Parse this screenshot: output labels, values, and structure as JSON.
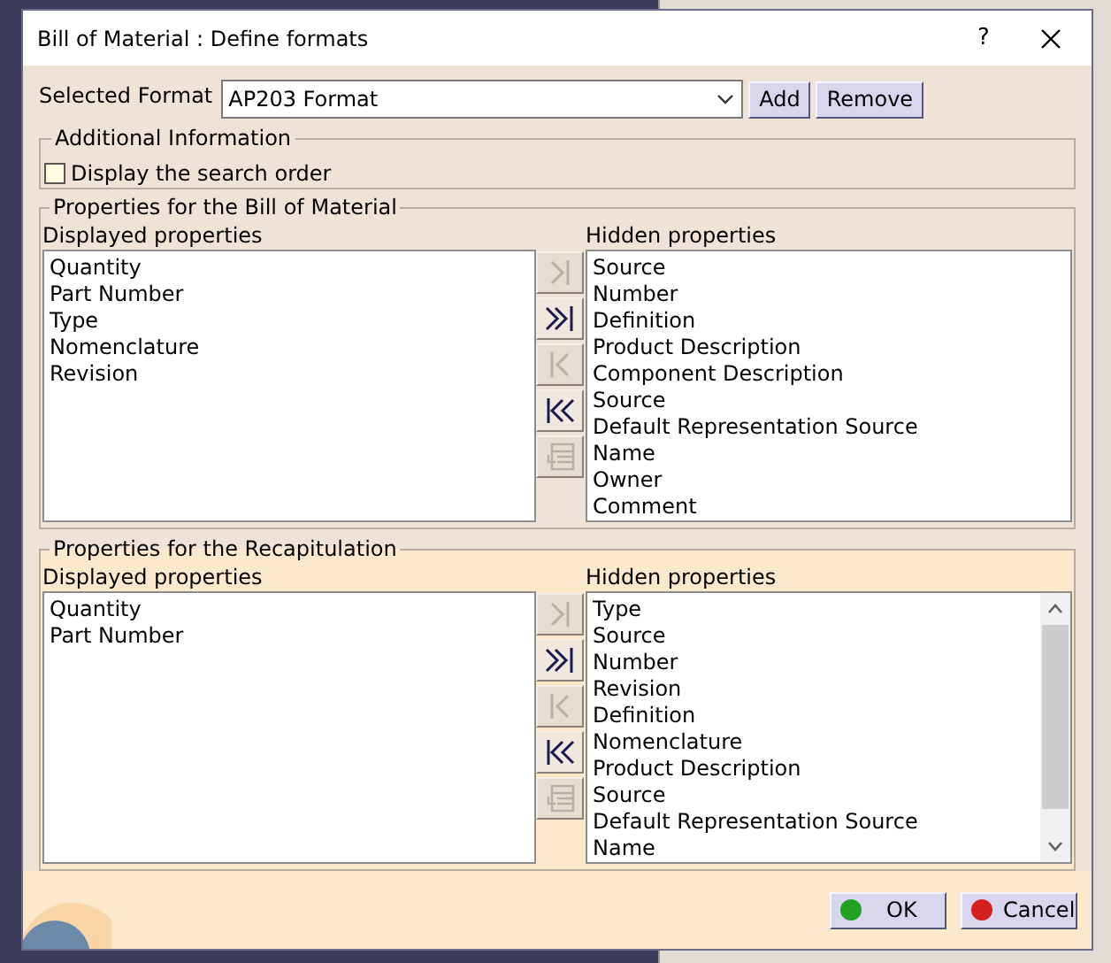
{
  "dialog": {
    "title": "Bill of Material : Define formats",
    "help": "?"
  },
  "selected_format": {
    "label": "Selected Format",
    "value": "AP203 Format"
  },
  "format_buttons": [
    "Add",
    "Remove"
  ],
  "additional_information": {
    "title": "Additional Information",
    "options": [
      {
        "label": "Display the search order",
        "checked": false
      }
    ]
  },
  "sections": [
    {
      "title": "Properties for the Bill of Material",
      "displayed_label": "Displayed properties",
      "displayed": [
        "Quantity",
        "Part Number",
        "Type",
        "Nomenclature",
        "Revision"
      ],
      "hidden_label": "Hidden properties",
      "hidden": [
        "Source",
        "Number",
        "Definition",
        "Product Description",
        "Component Description",
        "Source",
        "Default Representation Source",
        "Name",
        "Owner",
        "Comment"
      ],
      "scrollbar": false,
      "move_buttons": [
        {
          "kind": "move-one",
          "disabled": true
        },
        {
          "kind": "move-all",
          "disabled": false
        },
        {
          "kind": "back-one",
          "disabled": true
        },
        {
          "kind": "back-all",
          "disabled": false
        },
        {
          "kind": "edit",
          "disabled": true
        }
      ]
    },
    {
      "title": "Properties for the Recapitulation",
      "displayed_label": "Displayed properties",
      "displayed": [
        "Quantity",
        "Part Number"
      ],
      "hidden_label": "Hidden properties",
      "hidden": [
        "Type",
        "Source",
        "Number",
        "Revision",
        "Definition",
        "Nomenclature",
        "Product Description",
        "Source",
        "Default Representation Source",
        "Name"
      ],
      "scrollbar": true,
      "move_buttons": [
        {
          "kind": "move-one",
          "disabled": true
        },
        {
          "kind": "move-all",
          "disabled": false
        },
        {
          "kind": "back-one",
          "disabled": true
        },
        {
          "kind": "back-all",
          "disabled": false
        },
        {
          "kind": "edit",
          "disabled": true
        }
      ]
    }
  ],
  "footer_buttons": [
    {
      "label": "OK",
      "color": "#22a022"
    },
    {
      "label": "Cancel",
      "color": "#d42020"
    }
  ]
}
